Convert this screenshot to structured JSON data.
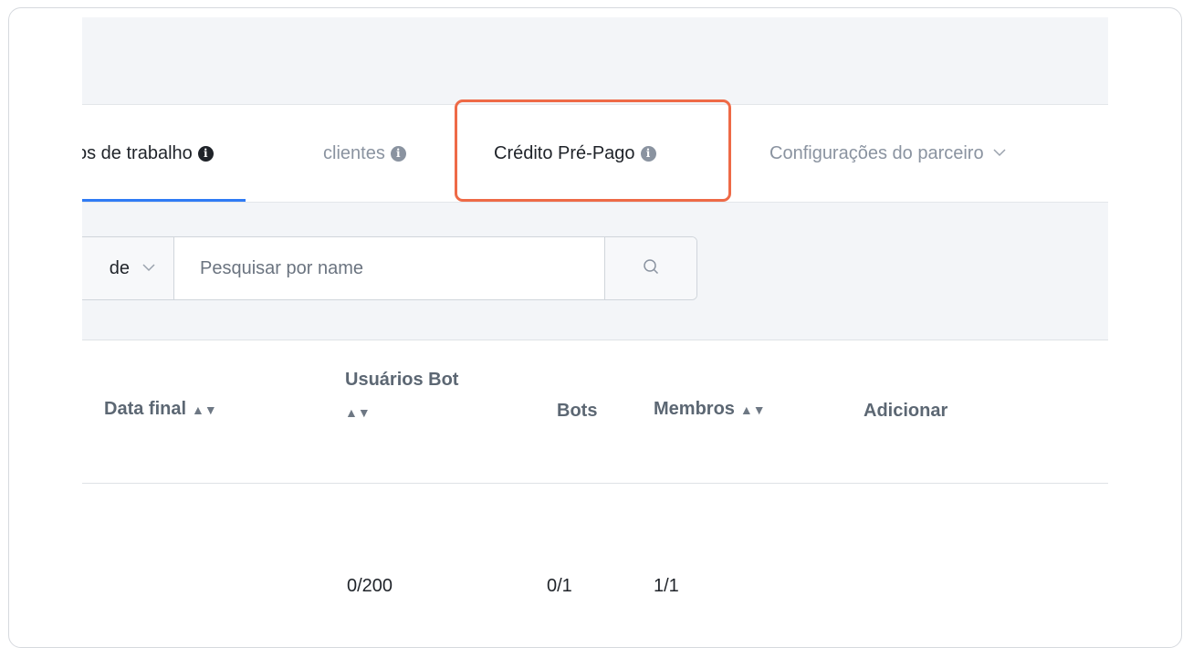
{
  "tabs": {
    "workspaces": "os de trabalho",
    "clients": "clientes",
    "credit": "Crédito Pré-Pago",
    "partner": "Configurações do parceiro"
  },
  "search": {
    "select_value": "de",
    "placeholder": "Pesquisar por name"
  },
  "table": {
    "headers": {
      "end_date": "Data final",
      "bot_users_line1": "Usuários Bot",
      "bots": "Bots",
      "members": "Membros",
      "add": "Adicionar"
    },
    "row": {
      "bot_users": "0/200",
      "bots": "0/1",
      "members": "1/1"
    }
  },
  "colors": {
    "highlight": "#ee6a47",
    "active_tab": "#2f7bf5"
  }
}
